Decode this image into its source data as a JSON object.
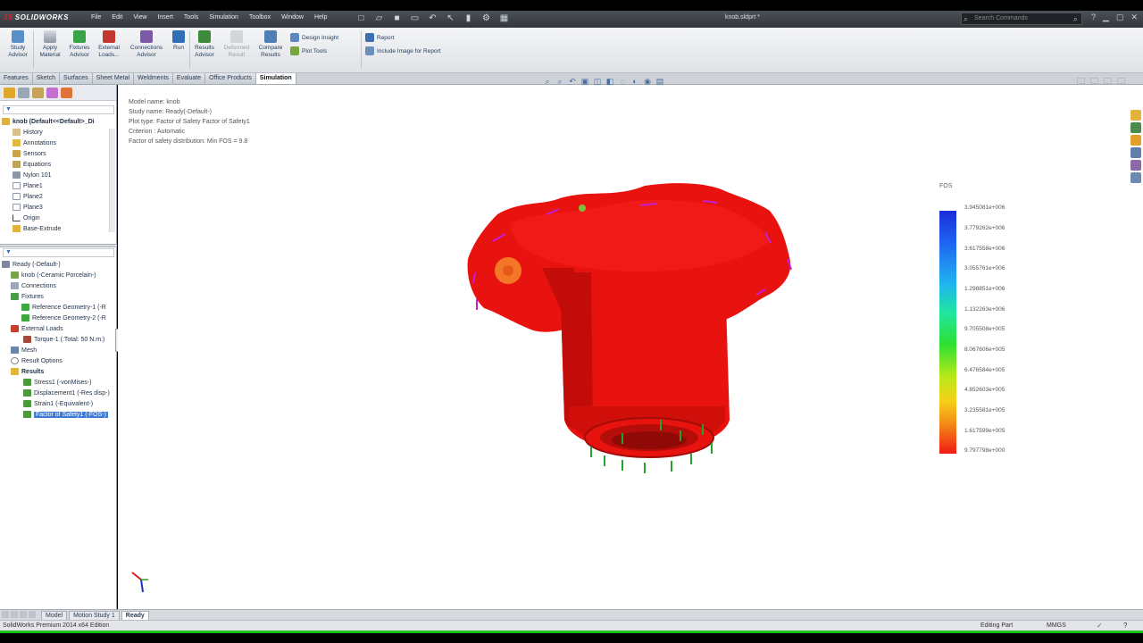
{
  "app": {
    "logo_text": "SOLIDWORKS",
    "logo_mark": "3S",
    "document_title": "knob.sldprt *",
    "menu": [
      "File",
      "Edit",
      "View",
      "Insert",
      "Tools",
      "Simulation",
      "Toolbox",
      "Window",
      "Help"
    ],
    "search_placeholder": "Search Commands"
  },
  "ribbon": {
    "buttons": [
      {
        "label": "Study\nAdvisor"
      },
      {
        "label": "Apply\nMaterial"
      },
      {
        "label": "Fixtures\nAdvisor"
      },
      {
        "label": "External\nLoads..."
      },
      {
        "label": "Connections\nAdvisor"
      },
      {
        "label": "Run"
      },
      {
        "label": "Results\nAdvisor"
      },
      {
        "label": "Deformed\nResult"
      },
      {
        "label": "Compare\nResults"
      }
    ],
    "small": [
      {
        "label": "Design Insight"
      },
      {
        "label": "Plot Tools"
      },
      {
        "label": "Report"
      },
      {
        "label": "Include Image for Report"
      }
    ]
  },
  "tabs": [
    "Features",
    "Sketch",
    "Surfaces",
    "Sheet Metal",
    "Weldments",
    "Evaluate",
    "Office Products",
    "Simulation"
  ],
  "active_tab": "Simulation",
  "feature_tree": {
    "root": "knob (Default<<Default>_Di",
    "items": [
      "History",
      "Annotations",
      "Sensors",
      "Equations",
      "Nylon 101",
      "Plane1",
      "Plane2",
      "Plane3",
      "Origin",
      "Base-Extrude"
    ]
  },
  "study_tree": {
    "root": "Ready (-Default-)",
    "items": [
      "knob (-Ceramic Porcelain-)",
      "Connections",
      "Fixtures",
      "Reference Geometry-1 (-R",
      "Reference Geometry-2 (-R",
      "External Loads",
      "Torque-1 (:Total: 50 N.m:)",
      "Mesh",
      "Result Options",
      "Results",
      "Stress1 (-vonMises-)",
      "Displacement1 (-Res disp-)",
      "Strain1 (-Equivalent-)",
      "Factor of Safety1 (-FOS-)"
    ],
    "selected": "Factor of Safety1 (-FOS-)"
  },
  "plot_info": {
    "line1": "Model name: knob",
    "line2": "Study name: Ready(-Default-)",
    "line3": "Plot type: Factor of Safety Factor of Safety1",
    "line4": "Criterion : Automatic",
    "line5": "Factor of safety distribution: Min FOS = 9.8"
  },
  "legend": {
    "title": "FOS",
    "values": [
      "3.945081e+006",
      "3.779262e+006",
      "3.617558e+006",
      "3.055761e+006",
      "1.298851e+006",
      "1.132263e+006",
      "9.705508e+005",
      "8.067606e+005",
      "6.476584e+005",
      "4.852603e+005",
      "3.235581e+005",
      "1.617599e+005",
      "9.797798e+000"
    ],
    "colors": {
      "high": "#1a2dd8",
      "low": "#f01a14"
    }
  },
  "model": {
    "color": "#e8120e"
  },
  "bottom_tabs": [
    "Model",
    "Motion Study 1",
    "Ready"
  ],
  "active_bottom_tab": "Ready",
  "status": {
    "left": "SolidWorks Premium 2014 x64 Edition",
    "mode": "Editing Part",
    "units": "MMGS",
    "help": "?"
  }
}
